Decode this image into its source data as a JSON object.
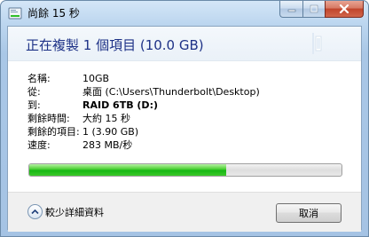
{
  "window": {
    "title": "尚餘 15 秒"
  },
  "header": {
    "title": "正在複製 1 個項目 (10.0 GB)"
  },
  "details": [
    {
      "label": "名稱:",
      "value": "10GB",
      "bold": false
    },
    {
      "label": "從:",
      "value": "桌面 (C:\\Users\\Thunderbolt\\Desktop)",
      "bold": false
    },
    {
      "label": "到:",
      "value": "RAID 6TB (D:)",
      "bold": true
    },
    {
      "label": "剩餘時間:",
      "value": "大約 15 秒",
      "bold": false
    },
    {
      "label": "剩餘的項目:",
      "value": "1 (3.90 GB)",
      "bold": false
    },
    {
      "label": "速度:",
      "value": "283 MB/秒",
      "bold": false
    }
  ],
  "progress": {
    "fraction": 0.63,
    "color": "#17b714"
  },
  "footer": {
    "toggle_label": "較少詳細資料",
    "toggle_icon": "chevron-up-icon",
    "cancel_label": "取消"
  },
  "icons": {
    "title_icon": "copy-progress-icon",
    "minimize": "minimize-icon",
    "maximize": "maximize-icon",
    "close": "close-icon"
  }
}
